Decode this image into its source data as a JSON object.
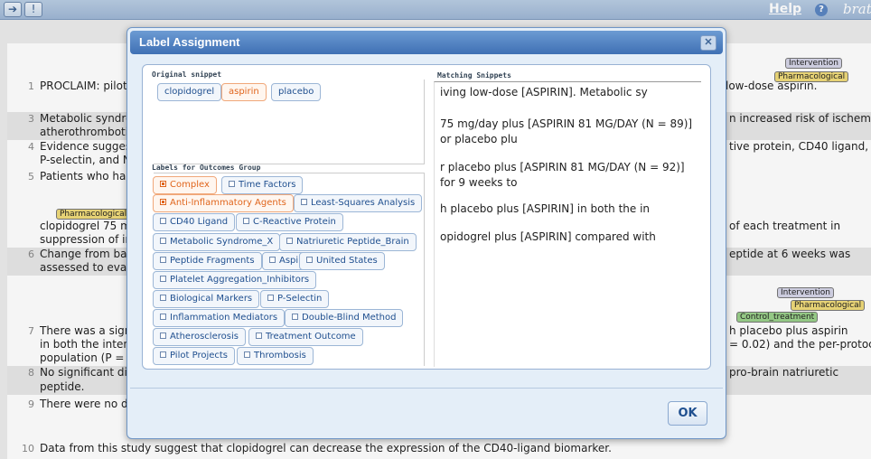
{
  "toolbar": {
    "nav_icon": "arrow-right-icon",
    "info_icon": "exclamation-icon",
    "help_label": "Help",
    "help_icon": "question-icon",
    "brand": "brat"
  },
  "document": {
    "rows": [
      {
        "num": "1",
        "left": "PROCLAIM: pilot",
        "right": "low-dose    aspirin.",
        "shade": false
      },
      {
        "num": "3",
        "left": "Metabolic syndro",
        "right": "n increased risk of ischemic",
        "shade": true
      },
      {
        "num": "",
        "left": "atherothrombotic",
        "right": "",
        "shade": true
      },
      {
        "num": "4",
        "left": "Evidence suggest",
        "right": "tive protein, CD40 ligand,",
        "shade": false
      },
      {
        "num": "",
        "left": "P-selectin, and N",
        "right": "",
        "shade": false
      },
      {
        "num": "5",
        "left": "Patients who had",
        "right": "",
        "shade": false
      },
      {
        "num": "",
        "left": "clopidogrel 75 m",
        "right": "of each treatment in",
        "shade": false
      },
      {
        "num": "",
        "left": "suppression of in",
        "right": "",
        "shade": false
      },
      {
        "num": "6",
        "left": "Change from bas",
        "right": "eptide at 6 weeks was",
        "shade": true
      },
      {
        "num": "",
        "left": "assessed to evalu",
        "right": "",
        "shade": true
      },
      {
        "num": "7",
        "left": "There was a sign",
        "right": "h    placebo plus aspirin",
        "shade": false
      },
      {
        "num": "",
        "left": "in both the intent",
        "right": "= 0.02) and the per-protocol",
        "shade": false
      },
      {
        "num": "",
        "left": "population (P = (",
        "right": "",
        "shade": false
      },
      {
        "num": "8",
        "left": "No significant dif",
        "right": "pro-brain natriuretic",
        "shade": true
      },
      {
        "num": "",
        "left": "peptide.",
        "right": "",
        "shade": true
      },
      {
        "num": "9",
        "left": "There were no de",
        "right": "",
        "shade": false
      },
      {
        "num": "10",
        "left": "Data from this study suggest that  clopidogrel   can decrease the expression of the CD40-ligand biomarker.",
        "right": "",
        "shade": false
      }
    ],
    "tags": {
      "intervention": "Intervention",
      "pharmacological": "Pharmacological",
      "control_treatment": "Control_treatment"
    }
  },
  "dialog": {
    "title": "Label Assignment",
    "close_icon": "close-icon",
    "original_legend": "Original snippet",
    "original_chips": [
      {
        "label": "clopidogrel",
        "selected": false
      },
      {
        "label": "aspirin",
        "selected": true
      },
      {
        "label": "placebo",
        "selected": false
      }
    ],
    "labels_legend": "Labels for Outcomes Group",
    "labels": [
      {
        "label": "Complex",
        "checked": true
      },
      {
        "label": "Time Factors",
        "checked": false
      },
      {
        "label": "Anti-Inflammatory Agents",
        "checked": true
      },
      {
        "label": "Least-Squares Analysis",
        "checked": false
      },
      {
        "label": "CD40 Ligand",
        "checked": false
      },
      {
        "label": "C-Reactive Protein",
        "checked": false
      },
      {
        "label": "Metabolic Syndrome_X",
        "checked": false
      },
      {
        "label": "Natriuretic Peptide_Brain",
        "checked": false
      },
      {
        "label": "Peptide Fragments",
        "checked": false
      },
      {
        "label": "Aspirin",
        "checked": false
      },
      {
        "label": "United States",
        "checked": false
      },
      {
        "label": "Platelet Aggregation_Inhibitors",
        "checked": false
      },
      {
        "label": "Biological Markers",
        "checked": false
      },
      {
        "label": "P-Selectin",
        "checked": false
      },
      {
        "label": "Inflammation Mediators",
        "checked": false
      },
      {
        "label": "Double-Blind Method",
        "checked": false
      },
      {
        "label": "Atherosclerosis",
        "checked": false
      },
      {
        "label": "Treatment Outcome",
        "checked": false
      },
      {
        "label": "Pilot Projects",
        "checked": false
      },
      {
        "label": "Thrombosis",
        "checked": false
      }
    ],
    "matching_legend": "Matching Snippets",
    "snippets": [
      "iving low-dose [ASPIRIN]. Metabolic sy",
      "75 mg/day plus [ASPIRIN 81 MG/DAY (N = 89)] or placebo plu",
      "r placebo plus [ASPIRIN 81 MG/DAY (N = 92)] for 9 weeks to",
      "h placebo plus [ASPIRIN] in both the in",
      "opidogrel plus [ASPIRIN] compared with"
    ],
    "ok_label": "OK"
  }
}
